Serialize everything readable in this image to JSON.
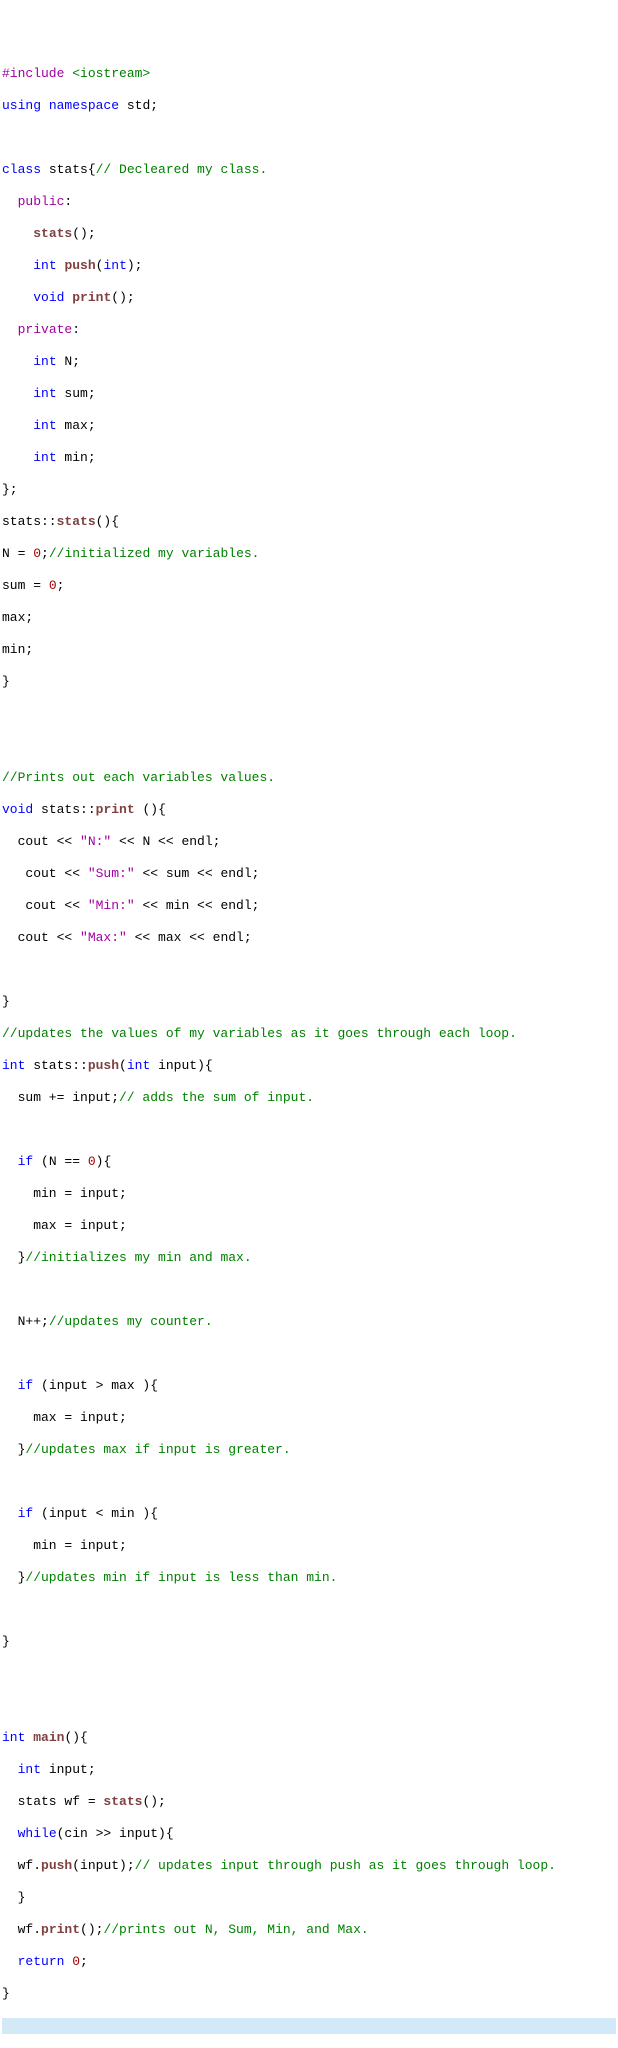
{
  "tokens": [
    [
      [
        "#include ",
        "pp"
      ],
      [
        "<iostream>",
        "inc"
      ]
    ],
    [
      [
        "using",
        "kw"
      ],
      [
        " ",
        "id"
      ],
      [
        "namespace",
        "kw"
      ],
      [
        " std;",
        "id"
      ]
    ],
    [
      [
        "",
        "id"
      ]
    ],
    [
      [
        "class",
        "kw"
      ],
      [
        " stats{",
        "id"
      ],
      [
        "// Decleared my class.",
        "cm"
      ]
    ],
    [
      [
        "  ",
        "id"
      ],
      [
        "public",
        "mod"
      ],
      [
        ":",
        "id"
      ]
    ],
    [
      [
        "    ",
        "id"
      ],
      [
        "stats",
        "fn"
      ],
      [
        "();",
        "id"
      ]
    ],
    [
      [
        "    ",
        "id"
      ],
      [
        "int",
        "kw"
      ],
      [
        " ",
        "id"
      ],
      [
        "push",
        "fn"
      ],
      [
        "(",
        "id"
      ],
      [
        "int",
        "kw"
      ],
      [
        ");",
        "id"
      ]
    ],
    [
      [
        "    ",
        "id"
      ],
      [
        "void",
        "kw"
      ],
      [
        " ",
        "id"
      ],
      [
        "print",
        "fn"
      ],
      [
        "();",
        "id"
      ]
    ],
    [
      [
        "  ",
        "id"
      ],
      [
        "private",
        "mod"
      ],
      [
        ":",
        "id"
      ]
    ],
    [
      [
        "    ",
        "id"
      ],
      [
        "int",
        "kw"
      ],
      [
        " N;",
        "id"
      ]
    ],
    [
      [
        "    ",
        "id"
      ],
      [
        "int",
        "kw"
      ],
      [
        " sum;",
        "id"
      ]
    ],
    [
      [
        "    ",
        "id"
      ],
      [
        "int",
        "kw"
      ],
      [
        " max;",
        "id"
      ]
    ],
    [
      [
        "    ",
        "id"
      ],
      [
        "int",
        "kw"
      ],
      [
        " min;",
        "id"
      ]
    ],
    [
      [
        "};",
        "id"
      ]
    ],
    [
      [
        "stats::",
        "id"
      ],
      [
        "stats",
        "fn"
      ],
      [
        "(){",
        "id"
      ]
    ],
    [
      [
        "N = ",
        "id"
      ],
      [
        "0",
        "num"
      ],
      [
        ";",
        "id"
      ],
      [
        "//initialized my variables.",
        "cm"
      ]
    ],
    [
      [
        "sum = ",
        "id"
      ],
      [
        "0",
        "num"
      ],
      [
        ";",
        "id"
      ]
    ],
    [
      [
        "max;",
        "id"
      ]
    ],
    [
      [
        "min;",
        "id"
      ]
    ],
    [
      [
        "}",
        "id"
      ]
    ],
    [
      [
        "",
        "id"
      ]
    ],
    [
      [
        "",
        "id"
      ]
    ],
    [
      [
        "//Prints out each variables values.",
        "cm"
      ]
    ],
    [
      [
        "void",
        "kw"
      ],
      [
        " stats::",
        "id"
      ],
      [
        "print",
        "fn"
      ],
      " ",
      [
        "(){",
        "id"
      ]
    ],
    [
      [
        "  cout << ",
        "id"
      ],
      [
        "\"N:\"",
        "str"
      ],
      [
        " << N << endl;",
        "id"
      ]
    ],
    [
      [
        "   cout << ",
        "id"
      ],
      [
        "\"Sum:\"",
        "str"
      ],
      [
        " << sum << endl;",
        "id"
      ]
    ],
    [
      [
        "   cout << ",
        "id"
      ],
      [
        "\"Min:\"",
        "str"
      ],
      [
        " << min << endl;",
        "id"
      ]
    ],
    [
      [
        "  cout << ",
        "id"
      ],
      [
        "\"Max:\"",
        "str"
      ],
      [
        " << max << endl;",
        "id"
      ]
    ],
    [
      [
        "",
        "id"
      ]
    ],
    [
      [
        "}",
        "id"
      ]
    ],
    [
      [
        "//updates the values of my variables as it goes through each loop.",
        "cm"
      ]
    ],
    [
      [
        "int",
        "kw"
      ],
      [
        " stats::",
        "id"
      ],
      [
        "push",
        "fn"
      ],
      [
        "(",
        "id"
      ],
      [
        "int",
        "kw"
      ],
      [
        " input){",
        "id"
      ]
    ],
    [
      [
        "  sum += input;",
        "id"
      ],
      [
        "// adds the sum of input.",
        "cm"
      ]
    ],
    [
      [
        "",
        "id"
      ]
    ],
    [
      [
        "  ",
        "id"
      ],
      [
        "if",
        "kw"
      ],
      [
        " (N == ",
        "id"
      ],
      [
        "0",
        "num"
      ],
      [
        "){",
        "id"
      ]
    ],
    [
      [
        "    min = input;",
        "id"
      ]
    ],
    [
      [
        "    max = input;",
        "id"
      ]
    ],
    [
      [
        "  }",
        "id"
      ],
      [
        "//initializes my min and max.",
        "cm"
      ]
    ],
    [
      [
        "",
        "id"
      ]
    ],
    [
      [
        "  N++;",
        "id"
      ],
      [
        "//updates my counter.",
        "cm"
      ]
    ],
    [
      [
        "",
        "id"
      ]
    ],
    [
      [
        "  ",
        "id"
      ],
      [
        "if",
        "kw"
      ],
      [
        " (input > max ){",
        "id"
      ]
    ],
    [
      [
        "    max = input;",
        "id"
      ]
    ],
    [
      [
        "  }",
        "id"
      ],
      [
        "//updates max if input is greater.",
        "cm"
      ]
    ],
    [
      [
        "",
        "id"
      ]
    ],
    [
      [
        "  ",
        "id"
      ],
      [
        "if",
        "kw"
      ],
      [
        " (input < min ){",
        "id"
      ]
    ],
    [
      [
        "    min = input;",
        "id"
      ]
    ],
    [
      [
        "  }",
        "id"
      ],
      [
        "//updates min if input is less than min.",
        "cm"
      ]
    ],
    [
      [
        "",
        "id"
      ]
    ],
    [
      [
        "}",
        "id"
      ]
    ],
    [
      [
        "",
        "id"
      ]
    ],
    [
      [
        "",
        "id"
      ]
    ],
    [
      [
        "int",
        "kw"
      ],
      [
        " ",
        "id"
      ],
      [
        "main",
        "fn"
      ],
      [
        "(){",
        "id"
      ]
    ],
    [
      [
        "  ",
        "id"
      ],
      [
        "int",
        "kw"
      ],
      [
        " input;",
        "id"
      ]
    ],
    [
      [
        "  stats wf = ",
        "id"
      ],
      [
        "stats",
        "fn"
      ],
      [
        "();",
        "id"
      ]
    ],
    [
      [
        "  ",
        "id"
      ],
      [
        "while",
        "kw"
      ],
      [
        "(cin >> input){",
        "id"
      ]
    ],
    [
      [
        "  wf.",
        "id"
      ],
      [
        "push",
        "fn"
      ],
      [
        "(input);",
        "id"
      ],
      [
        "// updates input through push as it goes through loop.",
        "cm"
      ]
    ],
    [
      [
        "  }",
        "id"
      ]
    ],
    [
      [
        "  wf.",
        "id"
      ],
      [
        "print",
        "fn"
      ],
      [
        "();",
        "id"
      ],
      [
        "//prints out N, Sum, Min, and Max.",
        "cm"
      ]
    ],
    [
      [
        "  ",
        "id"
      ],
      [
        "return",
        "kw"
      ],
      [
        " ",
        "id"
      ],
      [
        "0",
        "num"
      ],
      [
        ";",
        "id"
      ]
    ],
    [
      [
        "}",
        "id"
      ]
    ]
  ],
  "selected_last": true
}
